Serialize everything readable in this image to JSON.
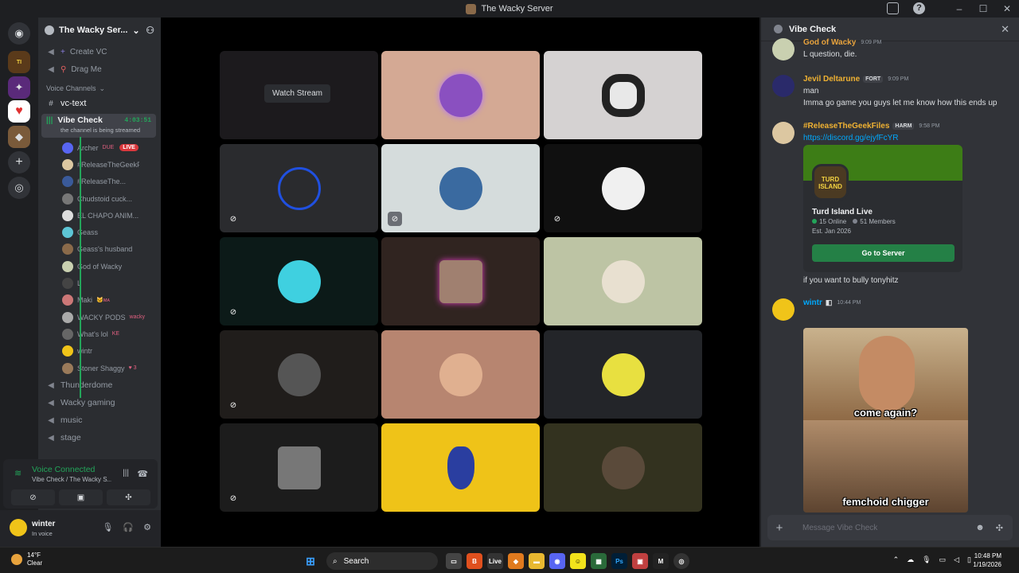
{
  "window": {
    "title": "The Wacky Server"
  },
  "server": {
    "name": "The Wacky Ser..."
  },
  "channels_top": [
    {
      "label": "Create VC",
      "icon": "plus-icon"
    },
    {
      "label": "Drag Me",
      "icon": "pin-icon"
    }
  ],
  "voice_category": "Voice Channels",
  "text_channel": "vc-text",
  "active_vc": {
    "name": "Vibe Check",
    "timer": "4:03:51",
    "status": "the channel is being streamed"
  },
  "members": [
    {
      "name": "Archer",
      "extra": "DUE",
      "live": "LIVE",
      "color": "#5865f2"
    },
    {
      "name": "#ReleaseTheGeekFiles",
      "color": "#dcc7a1"
    },
    {
      "name": "#ReleaseThe...",
      "color": "#3a5a9a"
    },
    {
      "name": "Chudstoid cuck...",
      "color": "#777"
    },
    {
      "name": "EL CHAPO ANIM...",
      "color": "#ddd"
    },
    {
      "name": "Geass",
      "color": "#5dc6d6"
    },
    {
      "name": "Geass's husband",
      "color": "#8a6a4a"
    },
    {
      "name": "God of Wacky",
      "color": "#c9d0b0"
    },
    {
      "name": "L",
      "color": "#444"
    },
    {
      "name": "Maki",
      "extra": "🐱ᴍᴀ",
      "color": "#c77"
    },
    {
      "name": "WACKY PODS",
      "extra": "wacky",
      "color": "#aaa"
    },
    {
      "name": "What's lol",
      "extra": "KE",
      "color": "#666"
    },
    {
      "name": "wintr",
      "color": "#f0c419"
    },
    {
      "name": "Stoner Shaggy",
      "extra": "♥ 3",
      "color": "#9a7a5a"
    }
  ],
  "channels_bottom": [
    "Thunderdome",
    "Wacky gaming",
    "music",
    "stage"
  ],
  "voice_panel": {
    "status": "Voice Connected",
    "location": "Vibe Check / The Wacky S..."
  },
  "user": {
    "name": "winter",
    "status": "In voice"
  },
  "stage": {
    "watch_label": "Watch Stream"
  },
  "chat": {
    "title": "Vibe Check",
    "messages": [
      {
        "author": "God of Wacky",
        "time": "9:09 PM",
        "lines": [
          "L question, die."
        ],
        "color": "#e8a33d"
      },
      {
        "author": "Jevil Deltarune",
        "tag": "FORT",
        "time": "9:09 PM",
        "lines": [
          "man",
          "Imma go game you guys let me know how this ends up"
        ],
        "color": "#f0b232"
      },
      {
        "author": "#ReleaseTheGeekFiles",
        "tag": "HARM",
        "time": "9:58 PM",
        "lines": [
          "https://discord.gg/ejyfFcYR",
          "if you want to bully tonyhitz"
        ],
        "color": "#f0b232"
      },
      {
        "author": "wintr",
        "time": "10:44 PM",
        "lines": [],
        "color": "#00a8fc"
      }
    ],
    "embed": {
      "icon_text": "TURD ISLAND",
      "name": "Turd Island Live",
      "online": "15 Online",
      "members": "51 Members",
      "est": "Est. Jan 2026",
      "button": "Go to Server"
    },
    "meme": {
      "top": "come again?",
      "bottom": "femchoid chigger"
    },
    "placeholder": "Message Vibe Check"
  },
  "taskbar": {
    "temp": "14°F",
    "weather": "Clear",
    "search": "Search",
    "time": "10:48 PM",
    "date": "1/19/2026"
  }
}
